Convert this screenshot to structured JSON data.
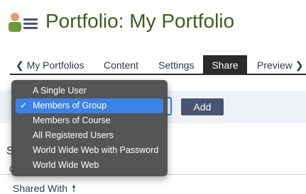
{
  "header": {
    "title": "Portfolio: My Portfolio",
    "user_icon": "user-icon",
    "menu_icon": "hamburger-menu-icon"
  },
  "tabs": [
    {
      "label": "My Portfolios",
      "icon": "chevron-left-icon"
    },
    {
      "label": "Content"
    },
    {
      "label": "Settings"
    },
    {
      "label": "Share",
      "active": true
    },
    {
      "label": "Preview",
      "icon": "chevron-right-icon"
    }
  ],
  "share": {
    "add_label": "Add"
  },
  "dropdown": {
    "options": [
      {
        "label": "A Single User",
        "selected": false
      },
      {
        "label": "Members of Group",
        "selected": true
      },
      {
        "label": "Members of Course",
        "selected": false
      },
      {
        "label": "All Registered Users",
        "selected": false
      },
      {
        "label": "World Wide Web with Password",
        "selected": false
      },
      {
        "label": "World Wide Web",
        "selected": false
      }
    ]
  },
  "peek": {
    "s": "S",
    "c": "C"
  },
  "shared_with": {
    "label": "Shared With",
    "sort_icon": "arrow-up-icon"
  },
  "colors": {
    "title": "#3f5a1f",
    "tab_active_bg": "#2b2b2b",
    "button_bg": "#4a5470",
    "selection": "#3b82e6",
    "panel_bg": "#eef2f6"
  }
}
